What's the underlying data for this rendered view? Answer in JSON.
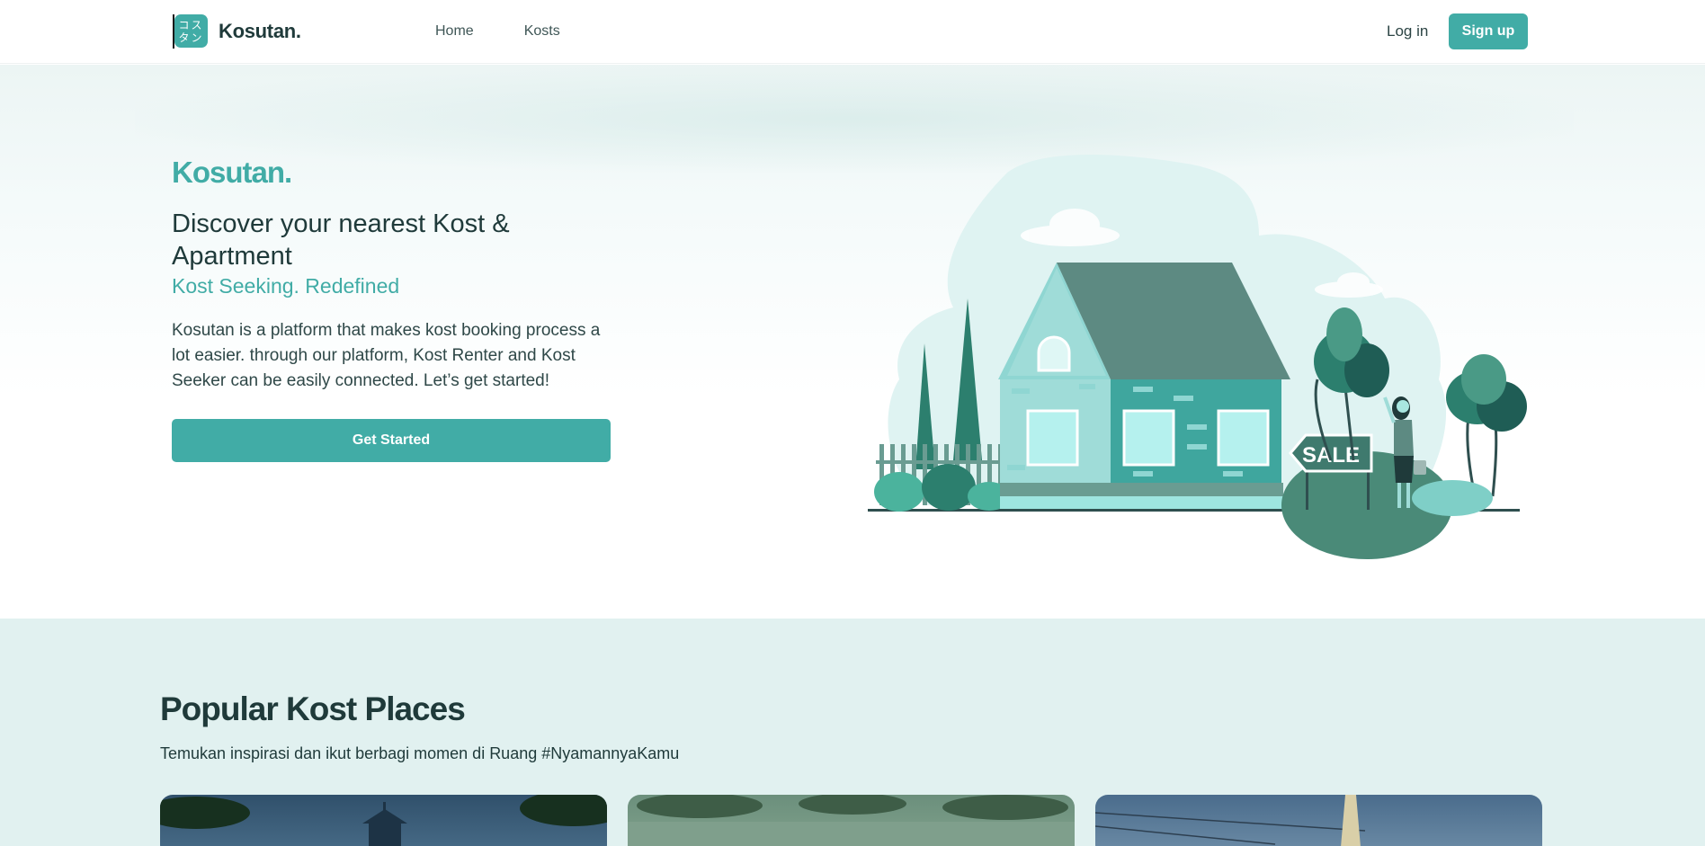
{
  "navbar": {
    "logo_glyphs": [
      "コス",
      "タン"
    ],
    "brand": "Kosutan.",
    "links": [
      "Home",
      "Kosts"
    ],
    "login": "Log in",
    "signup": "Sign up"
  },
  "hero": {
    "brand": "Kosutan.",
    "title": "Discover your nearest Kost & Apartment",
    "subtitle": "Kost Seeking. Redefined",
    "description": "Kosutan is a platform that makes kost booking process a lot easier. through our platform, Kost Renter and Kost Seeker can be easily connected. Let’s get started!",
    "cta": "Get Started",
    "sale_sign": "SALE"
  },
  "popular": {
    "title": "Popular Kost Places",
    "subtitle": "Temukan inspirasi dan ikut berbagi momen di Ruang #NyamannyaKamu"
  },
  "colors": {
    "accent": "#41aca6",
    "text_dark": "#1f3a3a",
    "section_bg": "#e1f1f0"
  }
}
